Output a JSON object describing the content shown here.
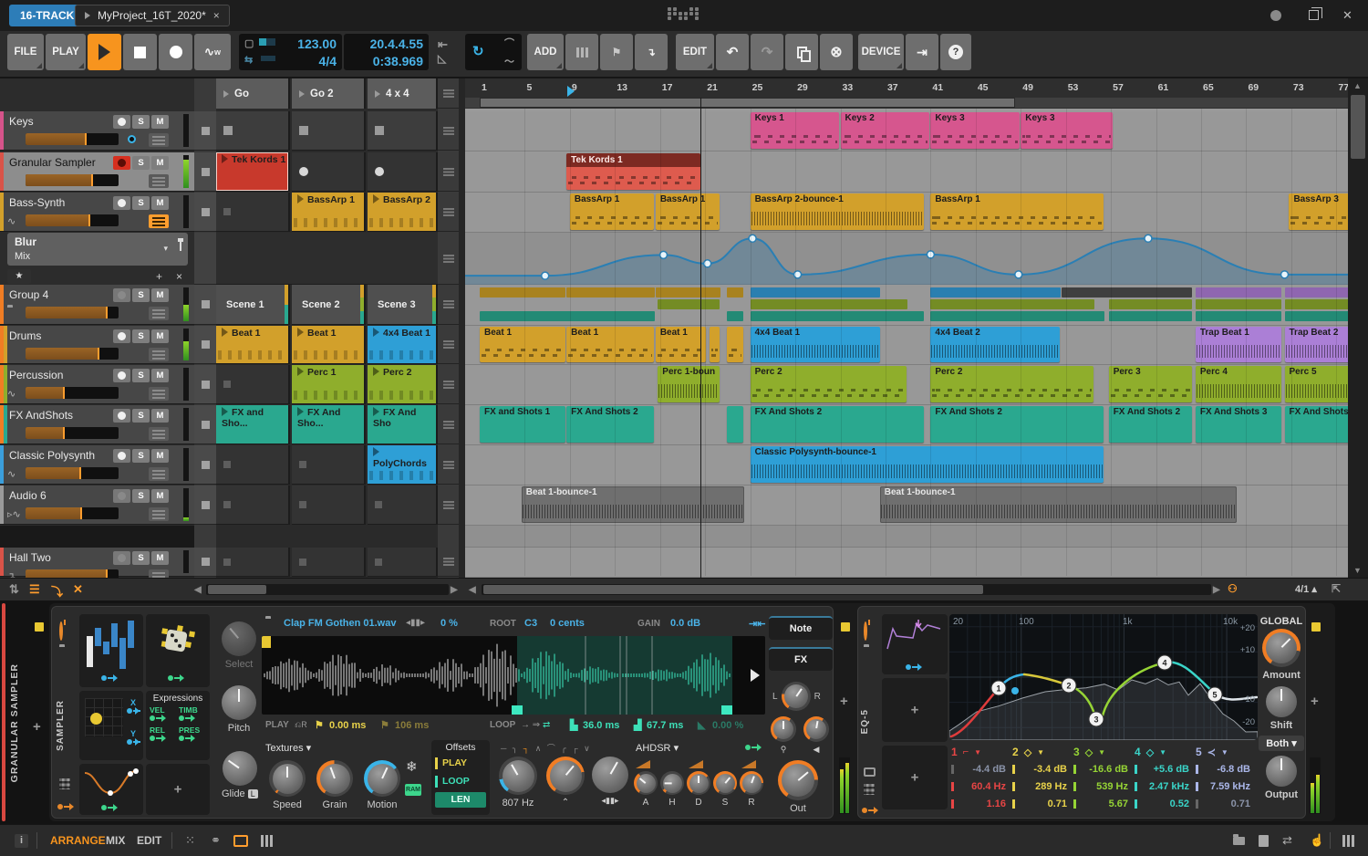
{
  "titlebar": {
    "badge": "16-TRACK",
    "tab_title": "MyProject_16T_2020*",
    "close": "×"
  },
  "transport": {
    "file": "FILE",
    "play": "PLAY",
    "tempo": "123.00",
    "time_sig": "4/4",
    "position": "20.4.4.55",
    "time": "0:38.969",
    "add": "ADD",
    "edit": "EDIT",
    "device": "DEVICE"
  },
  "scenes": [
    {
      "label": "Go"
    },
    {
      "label": "Go 2"
    },
    {
      "label": "4 x 4"
    }
  ],
  "ruler": {
    "ticks": [
      1,
      5,
      9,
      13,
      17,
      21,
      25,
      29,
      33,
      37,
      41,
      45,
      49,
      53,
      57,
      61,
      65,
      69,
      73,
      77
    ]
  },
  "add_track_label": "+",
  "zoom_grid_label": "4/1",
  "tracks": [
    {
      "id": "keys",
      "name": "Keys",
      "color": "#d6538a",
      "icon": "piano",
      "vol": 0.66,
      "arm": "on",
      "meter": 0,
      "pan_dot": true,
      "slots": [
        {
          "t": "stop"
        },
        {
          "t": "stop"
        },
        {
          "t": "stop"
        }
      ]
    },
    {
      "id": "granular",
      "name": "Granular Sampler",
      "color": "#d95348",
      "icon": "piano",
      "vol": 0.73,
      "arm": "rec",
      "selected": true,
      "meter": 0.85,
      "slots": [
        {
          "t": "clip",
          "label": "Tek Kords 1",
          "color": "#c8392c",
          "sel": true
        },
        {
          "t": "rec"
        },
        {
          "t": "rec"
        }
      ]
    },
    {
      "id": "bass",
      "name": "Bass-Synth",
      "color": "#d2a02b",
      "icon": "wave",
      "vol": 0.7,
      "arm": "on",
      "menu_hl": true,
      "slots": [
        {
          "t": "empty"
        },
        {
          "t": "clip",
          "label": "BassArp 1",
          "color": "#d2a02b",
          "notes": true
        },
        {
          "t": "clip",
          "label": "BassArp 2",
          "color": "#d2a02b",
          "notes": true
        }
      ]
    },
    {
      "id": "group4",
      "name": "Group 4",
      "color": "#f07d24",
      "icon": "folder",
      "vol": 0.88,
      "arm": "dim",
      "meter": 0.5,
      "group": true,
      "slots": [
        {
          "t": "scene",
          "label": "Scene 1"
        },
        {
          "t": "scene",
          "label": "Scene 2"
        },
        {
          "t": "scene",
          "label": "Scene 3"
        }
      ]
    },
    {
      "id": "drums",
      "name": "Drums",
      "color": "#d2a02b",
      "icon": "piano",
      "vol": 0.79,
      "arm": "on",
      "meter": 0.6,
      "child": true,
      "slots": [
        {
          "t": "clip",
          "label": "Beat 1",
          "color": "#d2a02b",
          "notes": true
        },
        {
          "t": "clip",
          "label": "Beat 1",
          "color": "#d2a02b",
          "notes": true
        },
        {
          "t": "clip",
          "label": "4x4 Beat 1",
          "color": "#2e9fd6",
          "notes": true
        }
      ]
    },
    {
      "id": "perc",
      "name": "Percussion",
      "color": "#8fae2c",
      "icon": "wave",
      "vol": 0.42,
      "arm": "on",
      "child": true,
      "slots": [
        {
          "t": "empty"
        },
        {
          "t": "clip",
          "label": "Perc 1",
          "color": "#8fae2c",
          "notes": true
        },
        {
          "t": "clip",
          "label": "Perc 2",
          "color": "#8fae2c",
          "notes": true
        }
      ]
    },
    {
      "id": "fx",
      "name": "FX AndShots",
      "color": "#2aa88f",
      "icon": "piano",
      "vol": 0.42,
      "arm": "on",
      "child": true,
      "slots": [
        {
          "t": "clip",
          "label": "FX and Sho...",
          "color": "#2aa88f"
        },
        {
          "t": "clip",
          "label": "FX And Sho...",
          "color": "#2aa88f"
        },
        {
          "t": "clip",
          "label": "FX And Sho",
          "color": "#2aa88f"
        }
      ]
    },
    {
      "id": "poly",
      "name": "Classic Polysynth",
      "color": "#3b9edb",
      "icon": "wave",
      "vol": 0.6,
      "arm": "on",
      "slots": [
        {
          "t": "empty"
        },
        {
          "t": "empty"
        },
        {
          "t": "clip",
          "label": "PolyChords",
          "color": "#2e9fd6",
          "notes": true
        }
      ]
    },
    {
      "id": "audio6",
      "name": "Audio 6",
      "color": "#9a9a9a",
      "icon": "audio",
      "vol": 0.61,
      "arm": "dim",
      "meter": 0.1,
      "slots": [
        {
          "t": "empty"
        },
        {
          "t": "empty"
        },
        {
          "t": "empty"
        }
      ]
    },
    {
      "id": "hall",
      "name": "Hall Two",
      "color": "#d95348",
      "icon": "return",
      "vol": 0.88,
      "arm": "dim",
      "slots": [
        {
          "t": "empty"
        },
        {
          "t": "empty"
        },
        {
          "t": "empty"
        }
      ]
    }
  ],
  "automation_header": {
    "device": "Blur",
    "param": "Mix",
    "fav": "★"
  },
  "arranger": {
    "playhead_bar": 20.6,
    "marker_bar": 8.8,
    "loop_region": [
      1,
      48.5
    ],
    "automation_points": [
      [
        6.8,
        0.02
      ],
      [
        17.3,
        0.55
      ],
      [
        21.2,
        0.33
      ],
      [
        25.2,
        0.97
      ],
      [
        29.2,
        0.05
      ],
      [
        41.0,
        0.56
      ],
      [
        48.8,
        0.05
      ],
      [
        60.3,
        0.97
      ],
      [
        72.4,
        0.05
      ]
    ],
    "rows": {
      "keys": [
        {
          "label": "Keys 1",
          "s": 25,
          "e": 33,
          "color": "#d6568e",
          "deco": "notes"
        },
        {
          "label": "Keys 2",
          "s": 33,
          "e": 41,
          "color": "#d6568e",
          "deco": "notes"
        },
        {
          "label": "Keys 3",
          "s": 41,
          "e": 49,
          "color": "#d6568e",
          "deco": "notes"
        },
        {
          "label": "Keys 3",
          "s": 49,
          "e": 57.3,
          "color": "#d6568e",
          "deco": "notes"
        }
      ],
      "granular": [
        {
          "label": "Tek Kords 1",
          "s": 8.7,
          "e": 20.7,
          "color": "#de5b4e",
          "deco": "notes",
          "selected": true
        }
      ],
      "bass": [
        {
          "label": "BassArp 1",
          "s": 9,
          "e": 16.6,
          "color": "#d2a02b",
          "deco": "notes"
        },
        {
          "label": "BassArp 1",
          "s": 16.6,
          "e": 22.4,
          "color": "#d2a02b",
          "deco": "notes"
        },
        {
          "label": "BassArp 2-bounce-1",
          "s": 25,
          "e": 40.5,
          "color": "#d2a02b",
          "deco": "audio"
        },
        {
          "label": "BassArp 1",
          "s": 41,
          "e": 56.5,
          "color": "#d2a02b",
          "deco": "notes"
        },
        {
          "label": "BassArp 3",
          "s": 72.8,
          "e": 78.8,
          "color": "#d2a02b",
          "deco": "notes"
        }
      ],
      "drums": [
        {
          "label": "Beat 1",
          "s": 1,
          "e": 8.7,
          "color": "#d2a02b",
          "deco": "notes"
        },
        {
          "label": "Beat 1",
          "s": 8.7,
          "e": 16.6,
          "color": "#d2a02b",
          "deco": "notes"
        },
        {
          "label": "Beat 1",
          "s": 16.6,
          "e": 21.2,
          "color": "#d2a02b",
          "deco": "notes"
        },
        {
          "label": "",
          "s": 21.4,
          "e": 22.4,
          "color": "#d2a02b",
          "deco": "notes"
        },
        {
          "label": "",
          "s": 22.9,
          "e": 24.5,
          "color": "#d2a02b",
          "deco": "notes"
        },
        {
          "label": "4x4 Beat 1",
          "s": 25,
          "e": 36.6,
          "color": "#2e9fd6",
          "deco": "audio"
        },
        {
          "label": "4x4 Beat 2",
          "s": 41,
          "e": 52.6,
          "color": "#2e9fd6",
          "deco": "audio"
        },
        {
          "label": "Trap Beat 1",
          "s": 64.5,
          "e": 72.2,
          "color": "#ab7fd6",
          "deco": "audio"
        },
        {
          "label": "Trap Beat 2",
          "s": 72.4,
          "e": 78.8,
          "color": "#ab7fd6",
          "deco": "audio"
        }
      ],
      "perc": [
        {
          "label": "Perc 1-boun",
          "s": 16.8,
          "e": 22.4,
          "color": "#8fae2c",
          "deco": "audio"
        },
        {
          "label": "Perc 2",
          "s": 25,
          "e": 39,
          "color": "#8fae2c",
          "deco": "notes"
        },
        {
          "label": "Perc 2",
          "s": 41,
          "e": 55.6,
          "color": "#8fae2c",
          "deco": "notes"
        },
        {
          "label": "Perc 3",
          "s": 56.8,
          "e": 64.3,
          "color": "#8fae2c",
          "deco": "notes"
        },
        {
          "label": "Perc 4",
          "s": 64.5,
          "e": 72.2,
          "color": "#8fae2c",
          "deco": "audio"
        },
        {
          "label": "Perc 5",
          "s": 72.4,
          "e": 78.8,
          "color": "#8fae2c",
          "deco": "audio"
        }
      ],
      "fx": [
        {
          "label": "FX and Shots 1",
          "s": 1,
          "e": 8.7,
          "color": "#2aa88f"
        },
        {
          "label": "FX And Shots 2",
          "s": 8.7,
          "e": 16.6,
          "color": "#2aa88f"
        },
        {
          "label": "",
          "s": 22.9,
          "e": 24.5,
          "color": "#2aa88f"
        },
        {
          "label": "FX And Shots 2",
          "s": 25,
          "e": 40.5,
          "color": "#2aa88f"
        },
        {
          "label": "FX And Shots 2",
          "s": 41,
          "e": 56.5,
          "color": "#2aa88f"
        },
        {
          "label": "FX And Shots 2",
          "s": 56.8,
          "e": 64.3,
          "color": "#2aa88f"
        },
        {
          "label": "FX And Shots 3",
          "s": 64.5,
          "e": 72.2,
          "color": "#2aa88f"
        },
        {
          "label": "FX And Shots",
          "s": 72.4,
          "e": 78.8,
          "color": "#2aa88f"
        }
      ],
      "poly": [
        {
          "label": "Classic Polysynth-bounce-1",
          "s": 25,
          "e": 56.5,
          "color": "#2e9fd6",
          "deco": "audio"
        }
      ],
      "audio6": [
        {
          "label": "Beat 1-bounce-1",
          "s": 4.7,
          "e": 24.6,
          "color": "#6f6f6f",
          "deco": "audio",
          "dark": true
        },
        {
          "label": "Beat 1-bounce-1",
          "s": 36.5,
          "e": 68.3,
          "color": "#6f6f6f",
          "deco": "audio",
          "dark": true
        }
      ],
      "hall": []
    },
    "group_lanes": [
      [
        {
          "s": 1,
          "e": 8.7,
          "c": "#a8821f"
        },
        {
          "s": 8.7,
          "e": 16.6,
          "c": "#a8821f"
        },
        {
          "s": 16.6,
          "e": 22.4,
          "c": "#a8821f"
        },
        {
          "s": 22.9,
          "e": 24.5,
          "c": "#a8821f"
        },
        {
          "s": 25,
          "e": 36.6,
          "c": "#2a7fb0"
        },
        {
          "s": 41,
          "e": 52.6,
          "c": "#2a7fb0"
        },
        {
          "s": 52.6,
          "e": 64.3,
          "c": "#3f3f3f"
        },
        {
          "s": 64.5,
          "e": 72.2,
          "c": "#8f66b0"
        },
        {
          "s": 72.4,
          "e": 78.8,
          "c": "#8f66b0"
        }
      ],
      [
        {
          "s": 16.8,
          "e": 22.4,
          "c": "#748c24"
        },
        {
          "s": 25,
          "e": 39,
          "c": "#748c24"
        },
        {
          "s": 41,
          "e": 55.6,
          "c": "#748c24"
        },
        {
          "s": 56.8,
          "e": 64.3,
          "c": "#748c24"
        },
        {
          "s": 64.5,
          "e": 72.2,
          "c": "#748c24"
        },
        {
          "s": 72.4,
          "e": 78.8,
          "c": "#748c24"
        }
      ],
      [
        {
          "s": 1,
          "e": 16.6,
          "c": "#238a75"
        },
        {
          "s": 22.9,
          "e": 24.5,
          "c": "#238a75"
        },
        {
          "s": 25,
          "e": 40.5,
          "c": "#238a75"
        },
        {
          "s": 41,
          "e": 56.5,
          "c": "#238a75"
        },
        {
          "s": 56.8,
          "e": 64.3,
          "c": "#238a75"
        },
        {
          "s": 64.5,
          "e": 72.2,
          "c": "#238a75"
        },
        {
          "s": 72.4,
          "e": 78.8,
          "c": "#238a75"
        }
      ]
    ]
  },
  "device_panel": {
    "track_label": "GRANULAR SAMPLER",
    "sampler": {
      "name": "SAMPLER",
      "file": "Clap FM Gothen 01.wav",
      "stretch": "0 %",
      "root_label": "ROOT",
      "root": "C3",
      "cents": "0 cents",
      "gain_label": "GAIN",
      "gain": "0.0 dB",
      "play_label": "PLAY",
      "play_start": "0.00 ms",
      "play_len": "106 ms",
      "loop_label": "LOOP",
      "loop_start": "36.0 ms",
      "loop_len": "67.7 ms",
      "loop_fade": "0.00 %",
      "select_label": "Select",
      "pitch_label": "Pitch",
      "glide_label": "Glide",
      "glide_mode": "L",
      "textures_title": "Textures",
      "texture_knobs": [
        "Speed",
        "Grain",
        "Motion"
      ],
      "offsets_title": "Offsets",
      "offset_items": [
        "PLAY",
        "LOOP",
        "LEN"
      ],
      "filter_freq": "807 Hz",
      "ahdsr_title": "AHDSR",
      "ahdsr_knobs": [
        "A",
        "H",
        "D",
        "S",
        "R"
      ],
      "expressions_title": "Expressions",
      "expression_items": [
        "VEL",
        "TIMB",
        "REL",
        "PRES"
      ],
      "xy_labels": [
        "X",
        "Y"
      ],
      "note_btn": "Note",
      "fx_btn": "FX",
      "pan_l": "L",
      "pan_r": "R",
      "out_label": "Out"
    },
    "eq": {
      "name": "EQ-5",
      "freq_labels": [
        "20",
        "100",
        "1k",
        "10k"
      ],
      "db_labels": [
        "+20",
        "+10",
        "-10",
        "-20"
      ],
      "bands": [
        {
          "n": "1",
          "color": "#e84545",
          "type_icon": "highpass",
          "gain": "-4.4 dB",
          "freq": "60.4 Hz",
          "q": "1.16",
          "gain_dim": true,
          "f": 60.4,
          "g": -4.4,
          "q_num": 1.16
        },
        {
          "n": "2",
          "color": "#e8d24a",
          "type_icon": "bell",
          "gain": "-3.4 dB",
          "freq": "289 Hz",
          "q": "0.71",
          "f": 289,
          "g": -3.4,
          "q_num": 0.71
        },
        {
          "n": "3",
          "color": "#96d435",
          "type_icon": "bell",
          "gain": "-16.6 dB",
          "freq": "539 Hz",
          "q": "5.67",
          "f": 539,
          "g": -16.6,
          "q_num": 5.67
        },
        {
          "n": "4",
          "color": "#3ad4c8",
          "type_icon": "bell",
          "gain": "+5.6 dB",
          "freq": "2.47 kHz",
          "q": "0.52",
          "f": 2470,
          "g": 5.6,
          "q_num": 0.52
        },
        {
          "n": "5",
          "color": "#aab6e8",
          "type_icon": "shelf",
          "gain": "-6.8 dB",
          "freq": "7.59 kHz",
          "q": "0.71",
          "q_dim": true,
          "f": 7590,
          "g": -6.8,
          "q_num": 0.71
        }
      ],
      "global_title": "GLOBAL",
      "global_knobs": [
        "Amount",
        "Shift",
        "Output"
      ],
      "global_mode": "Both"
    }
  },
  "statusbar": {
    "views": [
      "ARRANGE",
      "MIX",
      "EDIT"
    ],
    "info": "i"
  }
}
